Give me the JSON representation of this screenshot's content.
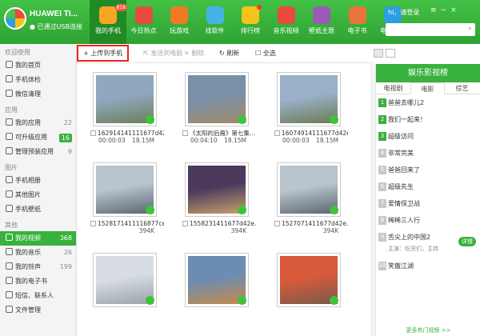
{
  "device": {
    "name": "HUAWEI TI...",
    "status": "已通过USB连接"
  },
  "nav": [
    {
      "label": "我的手机",
      "color": "#f6a623",
      "badge": "818"
    },
    {
      "label": "今日热点",
      "color": "#e84a3c"
    },
    {
      "label": "玩游戏",
      "color": "#f07b22"
    },
    {
      "label": "找软件",
      "color": "#44b4e6"
    },
    {
      "label": "排行榜",
      "color": "#f7c21a",
      "dot": true
    },
    {
      "label": "音乐视频",
      "color": "#e84a3c"
    },
    {
      "label": "壁纸主题",
      "color": "#9b59b6"
    },
    {
      "label": "电子书",
      "color": "#e8743c"
    },
    {
      "label": "电脑软件",
      "color": "#2d9ee0"
    }
  ],
  "header": {
    "login": "hi，请登录"
  },
  "sidebar": {
    "sections": [
      {
        "title": "欢迎使用",
        "items": [
          {
            "label": "我的首页"
          },
          {
            "label": "手机体检"
          },
          {
            "label": "微信清理"
          }
        ]
      },
      {
        "title": "应用",
        "items": [
          {
            "label": "我的应用",
            "count": "22"
          },
          {
            "label": "可升级应用",
            "count": "16",
            "badge": true
          },
          {
            "label": "管理预装应用",
            "count": "9"
          }
        ]
      },
      {
        "title": "图片",
        "items": [
          {
            "label": "手机相册"
          },
          {
            "label": "其他图片"
          },
          {
            "label": "手机壁纸"
          }
        ]
      },
      {
        "title": "其他",
        "items": [
          {
            "label": "我的视频",
            "count": "368",
            "selected": true
          },
          {
            "label": "我的音乐",
            "count": "26"
          },
          {
            "label": "我的铃声",
            "count": "199"
          },
          {
            "label": "我的电子书"
          },
          {
            "label": "短信、联系人"
          },
          {
            "label": "文件管理"
          }
        ]
      }
    ]
  },
  "toolbar": {
    "upload": "+ 上传到手机",
    "send": "发送到电脑",
    "delete": "删除",
    "refresh": "刷新",
    "select_all": "全选"
  },
  "videos": [
    {
      "name": "162914141111677d42e...",
      "duration": "00:00:03",
      "size": "18.15M"
    },
    {
      "name": "《太阳的后裔》第七集...",
      "duration": "00:04:10",
      "size": "18.15M"
    },
    {
      "name": "16074914111677d42e...",
      "duration": "00:00:03",
      "size": "18.15M"
    },
    {
      "name": "1528171411116877ce63f...",
      "duration": "",
      "size": "394K"
    },
    {
      "name": "1558231411677d42e...",
      "duration": "",
      "size": "394K"
    },
    {
      "name": "1527071411677d42e...",
      "duration": "",
      "size": "394K"
    },
    {
      "name": "",
      "duration": "",
      "size": ""
    },
    {
      "name": "",
      "duration": "",
      "size": ""
    },
    {
      "name": "",
      "duration": "",
      "size": ""
    }
  ],
  "panel": {
    "title": "娱乐影视榜",
    "tabs": [
      "电视剧",
      "电影",
      "综艺"
    ],
    "ranks": [
      {
        "n": "1",
        "title": "爸爸去哪儿2"
      },
      {
        "n": "2",
        "title": "我们一起来！"
      },
      {
        "n": "3",
        "title": "超级访问"
      },
      {
        "n": "4",
        "title": "非常完美"
      },
      {
        "n": "5",
        "title": "爸爸回来了"
      },
      {
        "n": "6",
        "title": "超级先生"
      },
      {
        "n": "7",
        "title": "爱情保卫战"
      },
      {
        "n": "8",
        "title": "稀稀三人行"
      },
      {
        "n": "9",
        "title": "舌尖上的中国2",
        "sub": "主演：吃货们，主持",
        "detail": "详情"
      },
      {
        "n": "10",
        "title": "笑傲江湖"
      }
    ],
    "more": "更多热门视频 >>"
  }
}
